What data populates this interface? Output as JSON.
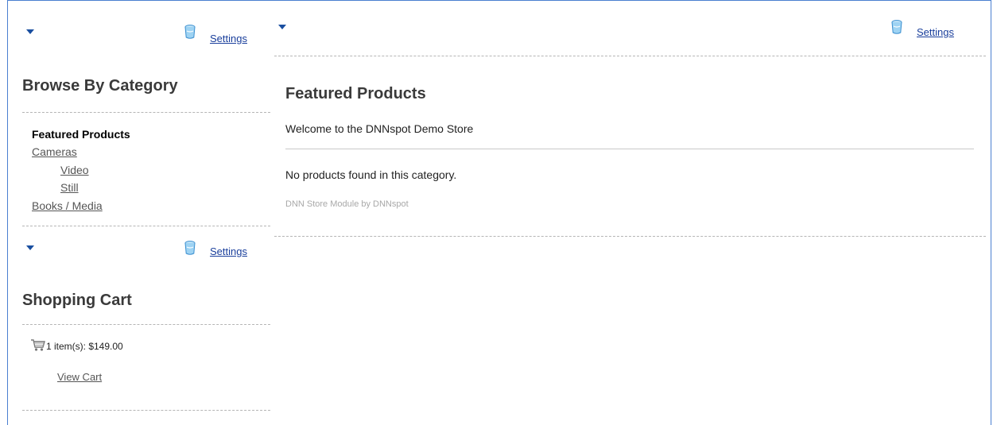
{
  "left_module_1": {
    "settings_label": "Settings",
    "title": "Browse By Category",
    "categories": [
      {
        "label": "Featured Products",
        "active": true
      },
      {
        "label": "Cameras",
        "active": false
      },
      {
        "label": "Video",
        "active": false
      },
      {
        "label": "Still",
        "active": false
      },
      {
        "label": "Books / Media",
        "active": false
      }
    ]
  },
  "left_module_2": {
    "settings_label": "Settings",
    "title": "Shopping Cart",
    "cart_summary": "1 item(s): $149.00",
    "view_cart_label": "View Cart"
  },
  "main_module": {
    "settings_label": "Settings",
    "title": "Featured Products",
    "welcome": "Welcome to the DNNspot Demo Store",
    "no_products": "No products found in this category.",
    "credit": "DNN Store Module by DNNspot"
  }
}
